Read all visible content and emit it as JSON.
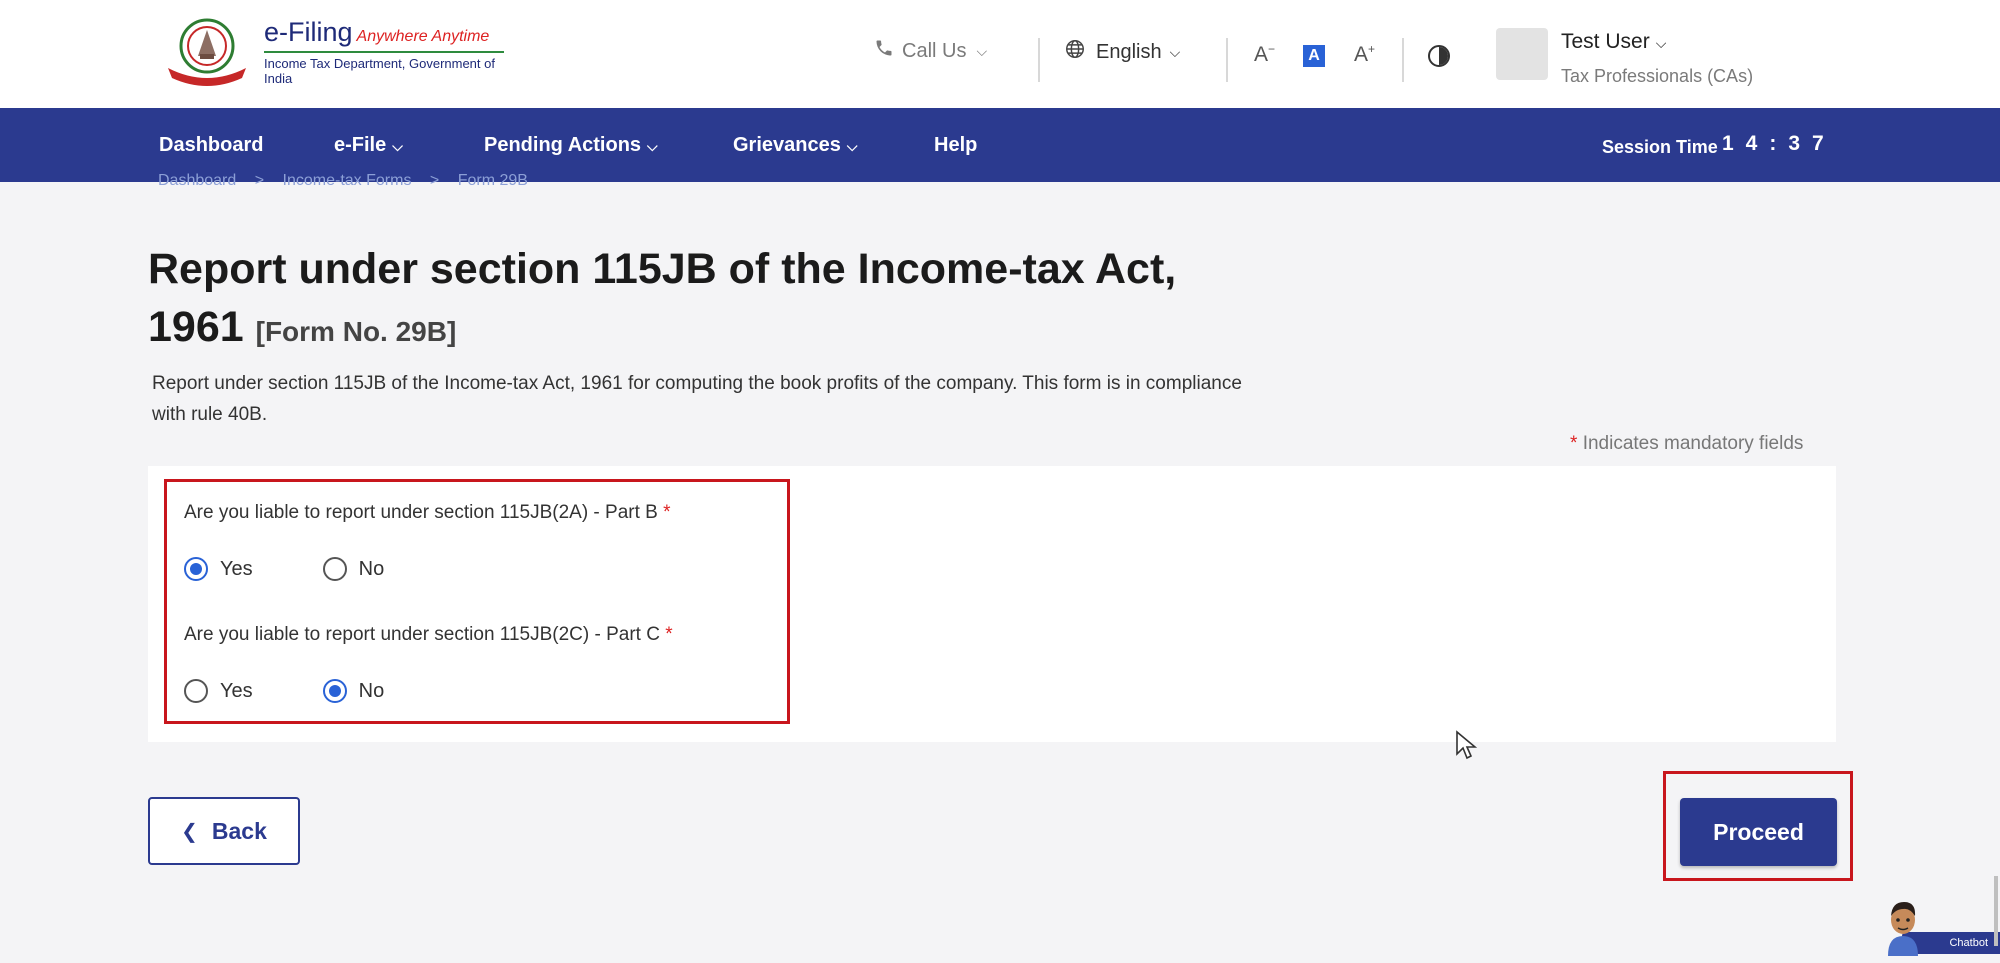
{
  "header": {
    "logo_title": "e-Filing",
    "logo_tagline": "Anywhere Anytime",
    "logo_subtitle": "Income Tax Department, Government of India",
    "call_us": "Call Us",
    "language": "English",
    "font_decrease": "A",
    "font_normal": "A",
    "font_increase": "A",
    "user_name": "Test User",
    "user_role": "Tax Professionals (CAs)"
  },
  "nav": {
    "items": [
      {
        "label": "Dashboard"
      },
      {
        "label": "e-File"
      },
      {
        "label": "Pending Actions"
      },
      {
        "label": "Grievances"
      },
      {
        "label": "Help"
      }
    ],
    "session_label": "Session Time",
    "session_time": "14:37"
  },
  "breadcrumb": [
    "Dashboard",
    ">",
    "Income-tax Forms",
    ">",
    "Form 29B"
  ],
  "page": {
    "title": "Report under section 115JB of the Income-tax Act, 1961",
    "form_no": "[Form No. 29B]",
    "description": "Report under section 115JB of the Income-tax Act, 1961 for computing the book profits of the company. This form is in compliance with rule 40B.",
    "mandatory_note": "Indicates mandatory fields",
    "mandatory_star": "*"
  },
  "questions": [
    {
      "label": "Are you liable to report under section 115JB(2A) - Part B",
      "star": "*",
      "options": [
        "Yes",
        "No"
      ],
      "selected": "Yes"
    },
    {
      "label": "Are you liable to report under section 115JB(2C) - Part C",
      "star": "*",
      "options": [
        "Yes",
        "No"
      ],
      "selected": "No"
    }
  ],
  "buttons": {
    "back": "Back",
    "proceed": "Proceed"
  },
  "chatbot": {
    "label": "Chatbot"
  },
  "colors": {
    "primary": "#2b3a8f",
    "accent": "#2962d6",
    "highlight": "#c8161d"
  }
}
